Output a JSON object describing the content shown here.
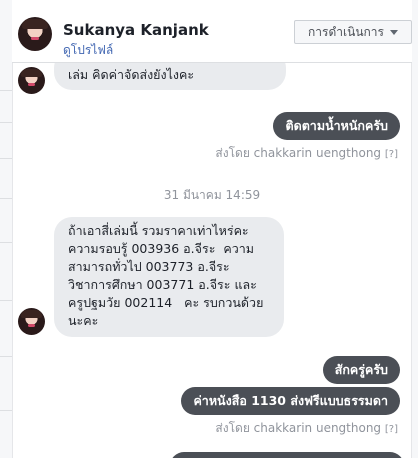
{
  "header": {
    "contact_name": "Sukanya Kanjank",
    "profile_link": "ดูโปรไฟล์",
    "actions_label": "การดำเนินการ"
  },
  "thread": {
    "msg_in_1": "เล่ม คิดค่าจัดส่งยังไงคะ",
    "msg_out_1": "ติดตามน้ำหนักครับ",
    "sent_by_1": "ส่งโดย chakkarin uengthong",
    "help_1": "[?]",
    "timestamp": "31 มีนาคม 14:59",
    "msg_in_2": "ถ้าเอาสี่เล่มนี้ รวมราคาเท่าไหร่คะ\nความรอบรู้ 003936 อ.จีระ  ความ\nสามารถทั่วไป 003773 อ.จีระ\nวิชาการศึกษา 003771 อ.จีระ และ\nครูปฐมวัย 002114   คะ รบกวนด้วย\nนะคะ",
    "msg_out_2": "สักครู่ครับ",
    "msg_out_3": "ค่าหนังสือ 1130 ส่งฟรีแบบธรรมดา",
    "sent_by_2": "ส่งโดย chakkarin uengthong",
    "help_2": "[?]"
  },
  "icons": {
    "dropdown": "chevron-down-icon",
    "avatar": "contact-avatar"
  },
  "colors": {
    "incoming_bubble": "#e9ebee",
    "outgoing_bubble": "#4b4f56",
    "link": "#4267b2",
    "muted_text": "#90949c"
  }
}
